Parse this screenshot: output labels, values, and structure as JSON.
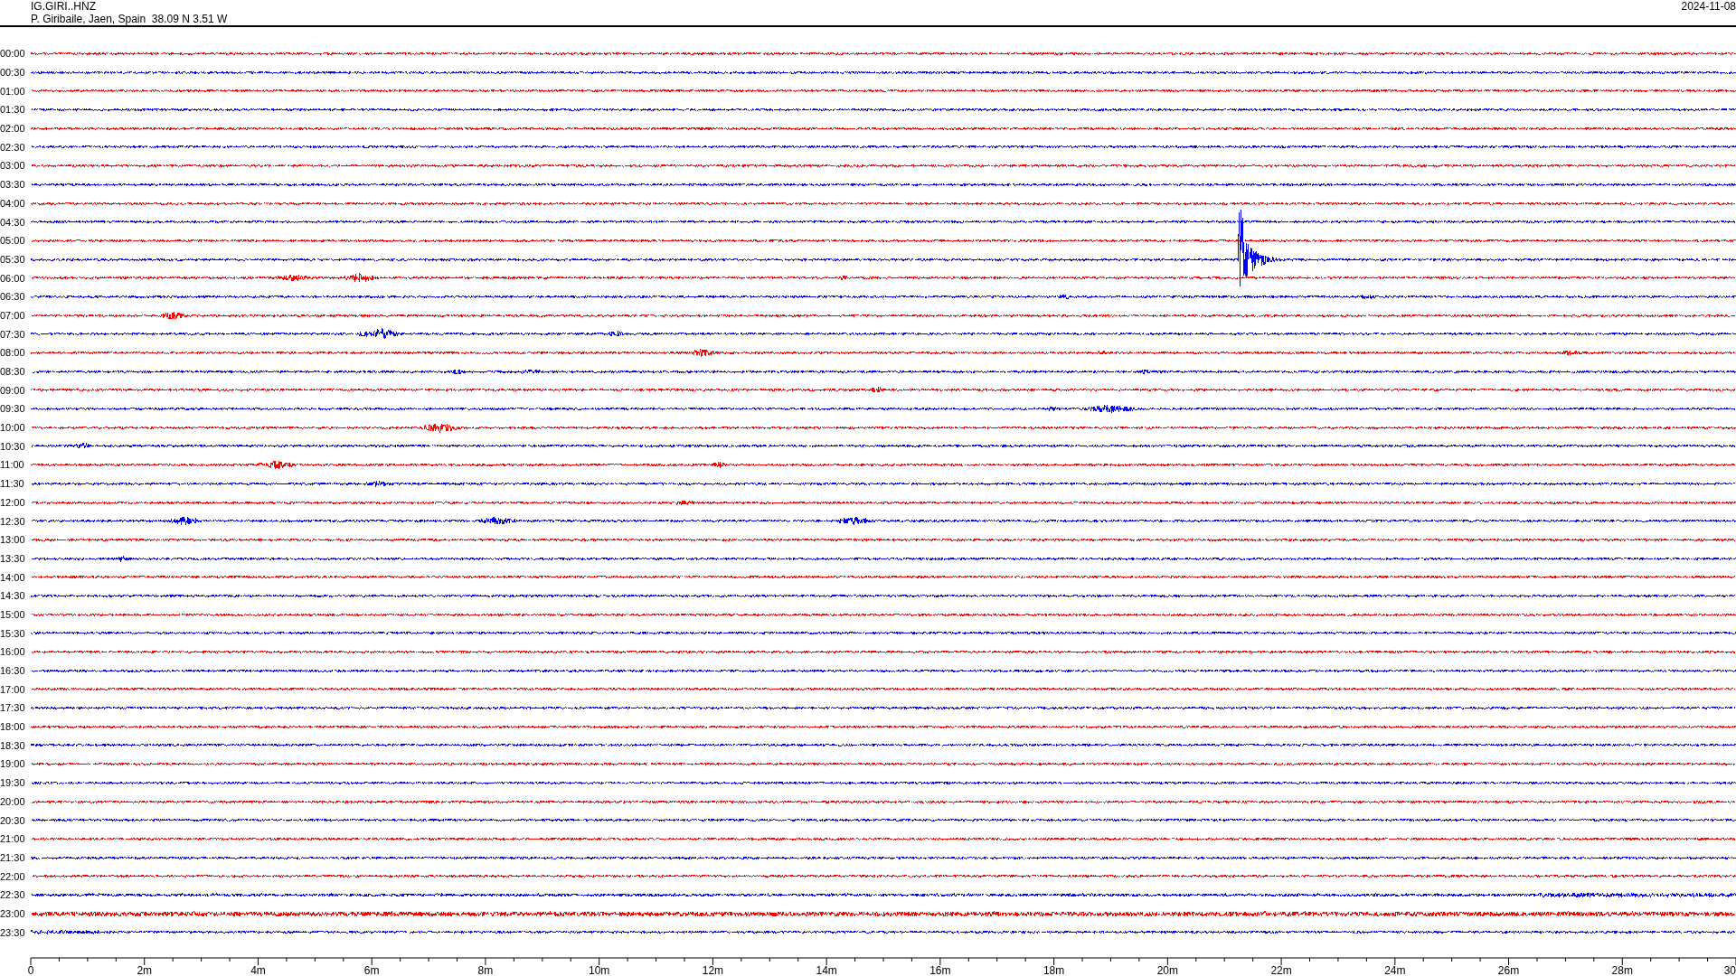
{
  "header": {
    "station": "IG.GIRI..HNZ",
    "location": "P. Giribaile, Jaen, Spain  38.09 N 3.51 W",
    "date": "2024-11-08"
  },
  "rows": [
    {
      "time": "00:00",
      "color": "#ff0000"
    },
    {
      "time": "00:30",
      "color": "#0000ff"
    },
    {
      "time": "01:00",
      "color": "#ff0000"
    },
    {
      "time": "01:30",
      "color": "#0000ff"
    },
    {
      "time": "02:00",
      "color": "#ff0000"
    },
    {
      "time": "02:30",
      "color": "#0000ff"
    },
    {
      "time": "03:00",
      "color": "#ff0000"
    },
    {
      "time": "03:30",
      "color": "#0000ff"
    },
    {
      "time": "04:00",
      "color": "#ff0000"
    },
    {
      "time": "04:30",
      "color": "#0000ff"
    },
    {
      "time": "05:00",
      "color": "#ff0000"
    },
    {
      "time": "05:30",
      "color": "#0000ff"
    },
    {
      "time": "06:00",
      "color": "#ff0000"
    },
    {
      "time": "06:30",
      "color": "#0000ff"
    },
    {
      "time": "07:00",
      "color": "#ff0000"
    },
    {
      "time": "07:30",
      "color": "#0000ff"
    },
    {
      "time": "08:00",
      "color": "#ff0000"
    },
    {
      "time": "08:30",
      "color": "#0000ff"
    },
    {
      "time": "09:00",
      "color": "#ff0000"
    },
    {
      "time": "09:30",
      "color": "#0000ff"
    },
    {
      "time": "10:00",
      "color": "#ff0000"
    },
    {
      "time": "10:30",
      "color": "#0000ff"
    },
    {
      "time": "11:00",
      "color": "#ff0000"
    },
    {
      "time": "11:30",
      "color": "#0000ff"
    },
    {
      "time": "12:00",
      "color": "#ff0000"
    },
    {
      "time": "12:30",
      "color": "#0000ff"
    },
    {
      "time": "13:00",
      "color": "#ff0000"
    },
    {
      "time": "13:30",
      "color": "#0000ff"
    },
    {
      "time": "14:00",
      "color": "#ff0000"
    },
    {
      "time": "14:30",
      "color": "#0000ff"
    },
    {
      "time": "15:00",
      "color": "#ff0000"
    },
    {
      "time": "15:30",
      "color": "#0000ff"
    },
    {
      "time": "16:00",
      "color": "#ff0000"
    },
    {
      "time": "16:30",
      "color": "#0000ff"
    },
    {
      "time": "17:00",
      "color": "#ff0000"
    },
    {
      "time": "17:30",
      "color": "#0000ff"
    },
    {
      "time": "18:00",
      "color": "#ff0000"
    },
    {
      "time": "18:30",
      "color": "#0000ff"
    },
    {
      "time": "19:00",
      "color": "#ff0000"
    },
    {
      "time": "19:30",
      "color": "#0000ff"
    },
    {
      "time": "20:00",
      "color": "#ff0000"
    },
    {
      "time": "20:30",
      "color": "#0000ff"
    },
    {
      "time": "21:00",
      "color": "#ff0000"
    },
    {
      "time": "21:30",
      "color": "#0000ff"
    },
    {
      "time": "22:00",
      "color": "#ff0000"
    },
    {
      "time": "22:30",
      "color": "#0000ff"
    },
    {
      "time": "23:00",
      "color": "#ff0000"
    },
    {
      "time": "23:30",
      "color": "#0000ff"
    }
  ],
  "x_axis": {
    "tick_labels": [
      "0",
      "2m",
      "4m",
      "6m",
      "8m",
      "10m",
      "12m",
      "14m",
      "16m",
      "18m",
      "20m",
      "22m",
      "24m",
      "26m",
      "28m",
      "30"
    ]
  }
}
